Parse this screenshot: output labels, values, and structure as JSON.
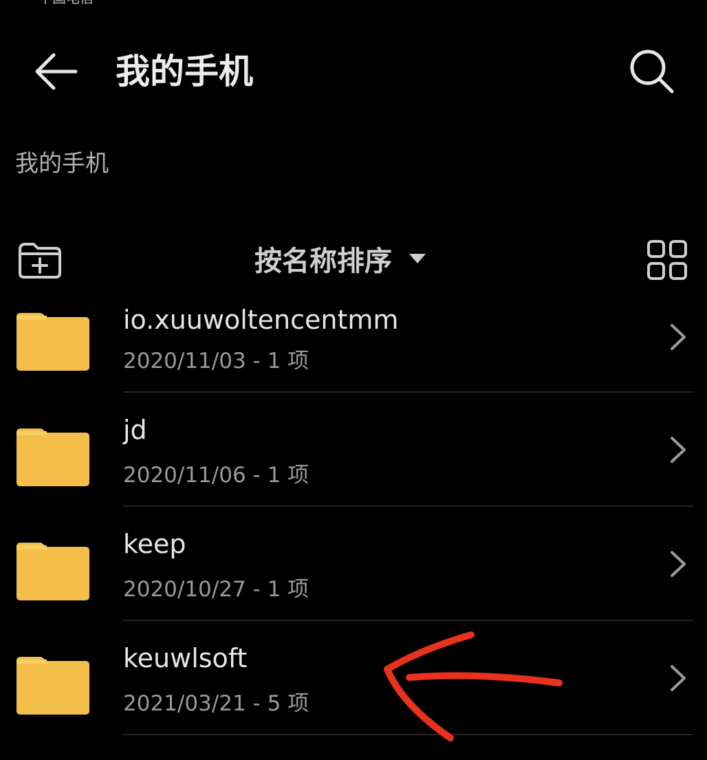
{
  "status_bar": {
    "carrier": "中国电信"
  },
  "header": {
    "title": "我的手机",
    "back_icon": "arrow-left-icon",
    "search_icon": "search-icon"
  },
  "breadcrumb": {
    "path": "我的手机"
  },
  "toolbar": {
    "new_folder_icon": "folder-add-icon",
    "sort_label": "按名称排序",
    "sort_caret_icon": "caret-down-icon",
    "view_toggle_icon": "grid-view-icon"
  },
  "files": [
    {
      "name": "io.xuuwoltencentmm",
      "meta": "2020/11/03 - 1 项"
    },
    {
      "name": "jd",
      "meta": "2020/11/06 - 1 项"
    },
    {
      "name": "keep",
      "meta": "2020/10/27 - 1 项"
    },
    {
      "name": "keuwlsoft",
      "meta": "2021/03/21 - 5 项"
    }
  ],
  "colors": {
    "background": "#000000",
    "folder": "#F3BE4A",
    "folder_tab": "#F8CF5F",
    "annotation": "#E8321E",
    "text_primary": "#E6E6E6",
    "text_secondary": "#9A9A9A"
  },
  "annotation": {
    "icon": "red-arrow-annotation",
    "target": "keuwlsoft"
  }
}
